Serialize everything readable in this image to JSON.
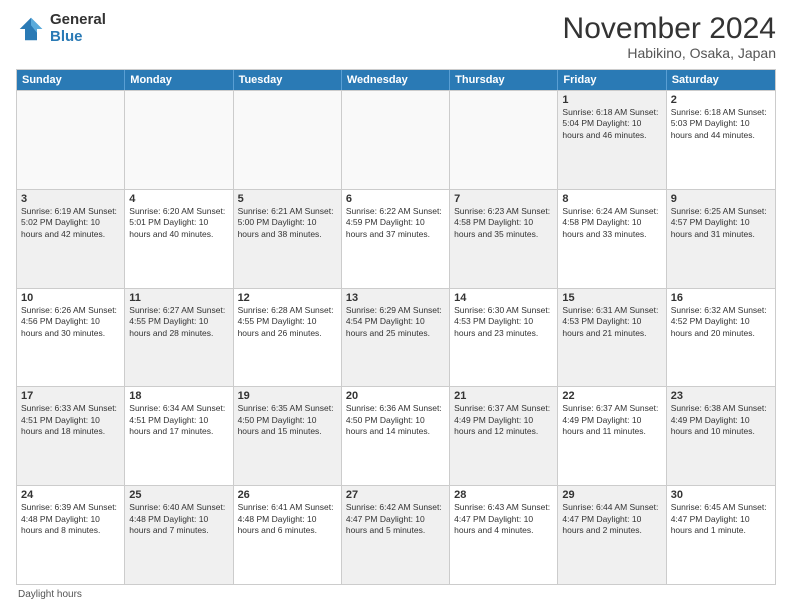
{
  "logo": {
    "general": "General",
    "blue": "Blue"
  },
  "title": "November 2024",
  "subtitle": "Habikino, Osaka, Japan",
  "days_header": [
    "Sunday",
    "Monday",
    "Tuesday",
    "Wednesday",
    "Thursday",
    "Friday",
    "Saturday"
  ],
  "weeks": [
    [
      {
        "day": "",
        "info": "",
        "empty": true
      },
      {
        "day": "",
        "info": "",
        "empty": true
      },
      {
        "day": "",
        "info": "",
        "empty": true
      },
      {
        "day": "",
        "info": "",
        "empty": true
      },
      {
        "day": "",
        "info": "",
        "empty": true
      },
      {
        "day": "1",
        "info": "Sunrise: 6:18 AM\nSunset: 5:04 PM\nDaylight: 10 hours\nand 46 minutes.",
        "shaded": true
      },
      {
        "day": "2",
        "info": "Sunrise: 6:18 AM\nSunset: 5:03 PM\nDaylight: 10 hours\nand 44 minutes.",
        "shaded": false
      }
    ],
    [
      {
        "day": "3",
        "info": "Sunrise: 6:19 AM\nSunset: 5:02 PM\nDaylight: 10 hours\nand 42 minutes.",
        "shaded": true
      },
      {
        "day": "4",
        "info": "Sunrise: 6:20 AM\nSunset: 5:01 PM\nDaylight: 10 hours\nand 40 minutes.",
        "shaded": false
      },
      {
        "day": "5",
        "info": "Sunrise: 6:21 AM\nSunset: 5:00 PM\nDaylight: 10 hours\nand 38 minutes.",
        "shaded": true
      },
      {
        "day": "6",
        "info": "Sunrise: 6:22 AM\nSunset: 4:59 PM\nDaylight: 10 hours\nand 37 minutes.",
        "shaded": false
      },
      {
        "day": "7",
        "info": "Sunrise: 6:23 AM\nSunset: 4:58 PM\nDaylight: 10 hours\nand 35 minutes.",
        "shaded": true
      },
      {
        "day": "8",
        "info": "Sunrise: 6:24 AM\nSunset: 4:58 PM\nDaylight: 10 hours\nand 33 minutes.",
        "shaded": false
      },
      {
        "day": "9",
        "info": "Sunrise: 6:25 AM\nSunset: 4:57 PM\nDaylight: 10 hours\nand 31 minutes.",
        "shaded": true
      }
    ],
    [
      {
        "day": "10",
        "info": "Sunrise: 6:26 AM\nSunset: 4:56 PM\nDaylight: 10 hours\nand 30 minutes.",
        "shaded": false
      },
      {
        "day": "11",
        "info": "Sunrise: 6:27 AM\nSunset: 4:55 PM\nDaylight: 10 hours\nand 28 minutes.",
        "shaded": true
      },
      {
        "day": "12",
        "info": "Sunrise: 6:28 AM\nSunset: 4:55 PM\nDaylight: 10 hours\nand 26 minutes.",
        "shaded": false
      },
      {
        "day": "13",
        "info": "Sunrise: 6:29 AM\nSunset: 4:54 PM\nDaylight: 10 hours\nand 25 minutes.",
        "shaded": true
      },
      {
        "day": "14",
        "info": "Sunrise: 6:30 AM\nSunset: 4:53 PM\nDaylight: 10 hours\nand 23 minutes.",
        "shaded": false
      },
      {
        "day": "15",
        "info": "Sunrise: 6:31 AM\nSunset: 4:53 PM\nDaylight: 10 hours\nand 21 minutes.",
        "shaded": true
      },
      {
        "day": "16",
        "info": "Sunrise: 6:32 AM\nSunset: 4:52 PM\nDaylight: 10 hours\nand 20 minutes.",
        "shaded": false
      }
    ],
    [
      {
        "day": "17",
        "info": "Sunrise: 6:33 AM\nSunset: 4:51 PM\nDaylight: 10 hours\nand 18 minutes.",
        "shaded": true
      },
      {
        "day": "18",
        "info": "Sunrise: 6:34 AM\nSunset: 4:51 PM\nDaylight: 10 hours\nand 17 minutes.",
        "shaded": false
      },
      {
        "day": "19",
        "info": "Sunrise: 6:35 AM\nSunset: 4:50 PM\nDaylight: 10 hours\nand 15 minutes.",
        "shaded": true
      },
      {
        "day": "20",
        "info": "Sunrise: 6:36 AM\nSunset: 4:50 PM\nDaylight: 10 hours\nand 14 minutes.",
        "shaded": false
      },
      {
        "day": "21",
        "info": "Sunrise: 6:37 AM\nSunset: 4:49 PM\nDaylight: 10 hours\nand 12 minutes.",
        "shaded": true
      },
      {
        "day": "22",
        "info": "Sunrise: 6:37 AM\nSunset: 4:49 PM\nDaylight: 10 hours\nand 11 minutes.",
        "shaded": false
      },
      {
        "day": "23",
        "info": "Sunrise: 6:38 AM\nSunset: 4:49 PM\nDaylight: 10 hours\nand 10 minutes.",
        "shaded": true
      }
    ],
    [
      {
        "day": "24",
        "info": "Sunrise: 6:39 AM\nSunset: 4:48 PM\nDaylight: 10 hours\nand 8 minutes.",
        "shaded": false
      },
      {
        "day": "25",
        "info": "Sunrise: 6:40 AM\nSunset: 4:48 PM\nDaylight: 10 hours\nand 7 minutes.",
        "shaded": true
      },
      {
        "day": "26",
        "info": "Sunrise: 6:41 AM\nSunset: 4:48 PM\nDaylight: 10 hours\nand 6 minutes.",
        "shaded": false
      },
      {
        "day": "27",
        "info": "Sunrise: 6:42 AM\nSunset: 4:47 PM\nDaylight: 10 hours\nand 5 minutes.",
        "shaded": true
      },
      {
        "day": "28",
        "info": "Sunrise: 6:43 AM\nSunset: 4:47 PM\nDaylight: 10 hours\nand 4 minutes.",
        "shaded": false
      },
      {
        "day": "29",
        "info": "Sunrise: 6:44 AM\nSunset: 4:47 PM\nDaylight: 10 hours\nand 2 minutes.",
        "shaded": true
      },
      {
        "day": "30",
        "info": "Sunrise: 6:45 AM\nSunset: 4:47 PM\nDaylight: 10 hours\nand 1 minute.",
        "shaded": false
      }
    ]
  ],
  "footer": "Daylight hours"
}
